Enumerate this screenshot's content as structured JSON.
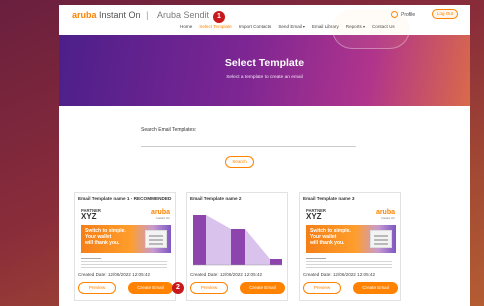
{
  "brand": {
    "name": "aruba",
    "product": "Instant On",
    "separator": "|",
    "app": "Aruba Sendit"
  },
  "nav": {
    "items": [
      "Home",
      "Select Template",
      "Import Contacts",
      "Send Email",
      "Email Library",
      "Reports",
      "Contact Us"
    ],
    "active": "Select Template",
    "profile_label": "Profile",
    "logout_label": "Log Out"
  },
  "markers": {
    "m1": "1",
    "m2": "2"
  },
  "hero": {
    "title": "Select Template",
    "subtitle": "Select a template to create an email"
  },
  "search": {
    "label": "Search Email Templates:",
    "value": "",
    "button_label": "Search"
  },
  "cards": [
    {
      "title": "Email Template name 1 - RECOMMENDED",
      "date": "Created Date: 12/06/2022 12:05:42",
      "preview_label": "Preview",
      "create_label": "Create Email",
      "thumb": {
        "partner": "PARTNER",
        "company": "XYZ",
        "logo": "aruba",
        "logo_sub": "Instant On",
        "headline": [
          "Switch to simple.",
          "Your wallet",
          "will thank you."
        ]
      }
    },
    {
      "title": "Email Template name 2",
      "date": "Created Date: 12/06/2022 12:05:42",
      "preview_label": "Preview",
      "create_label": "Create Email"
    },
    {
      "title": "Email Template name 3",
      "date": "Created Date: 12/06/2022 12:05:42",
      "preview_label": "Preview",
      "create_label": "Create Email",
      "thumb": {
        "partner": "PARTNER",
        "company": "XYZ",
        "logo": "aruba",
        "logo_sub": "Instant On",
        "headline": [
          "Switch to simple.",
          "Your wallet",
          "will thank you."
        ]
      }
    }
  ],
  "colors": {
    "accent": "#ff8200",
    "hero_start": "#4c1f8a",
    "hero_end": "#d96a4a",
    "marker": "#c8181c"
  }
}
